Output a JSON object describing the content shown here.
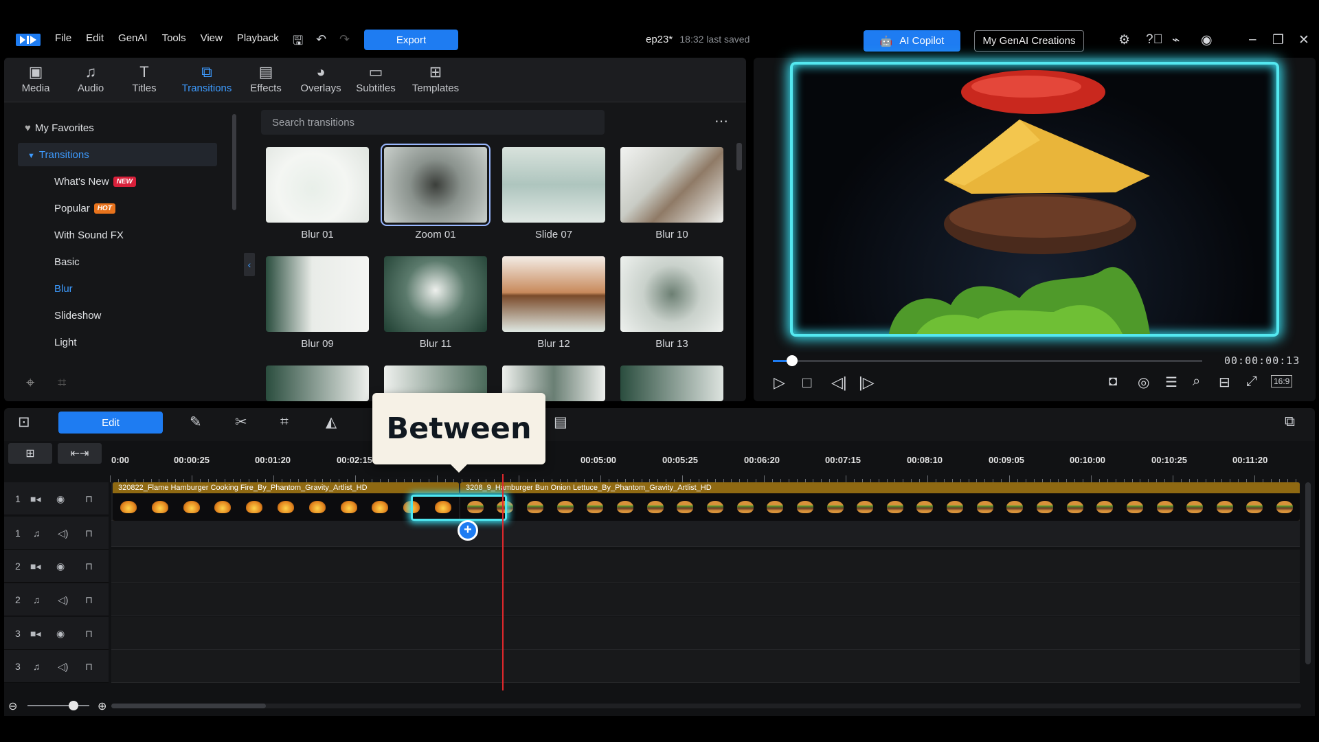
{
  "menu": {
    "items": [
      "File",
      "Edit",
      "GenAI",
      "Tools",
      "View",
      "Playback"
    ],
    "export_label": "Export"
  },
  "project": {
    "name": "ep23*",
    "saved": "18:32 last saved"
  },
  "header": {
    "copilot_label": "AI Copilot",
    "creations_label": "My GenAI Creations"
  },
  "tabs": [
    {
      "label": "Media",
      "icon": "media-icon"
    },
    {
      "label": "Audio",
      "icon": "music-note-icon"
    },
    {
      "label": "Titles",
      "icon": "text-icon"
    },
    {
      "label": "Transitions",
      "icon": "transition-icon",
      "active": true
    },
    {
      "label": "Effects",
      "icon": "effects-icon"
    },
    {
      "label": "Overlays",
      "icon": "overlay-icon"
    },
    {
      "label": "Subtitles",
      "icon": "subtitles-icon"
    },
    {
      "label": "Templates",
      "icon": "templates-icon"
    }
  ],
  "sidebar": {
    "favorites": "My Favorites",
    "transitions": "Transitions",
    "items": [
      {
        "label": "What's New",
        "badge": "NEW"
      },
      {
        "label": "Popular",
        "badge": "HOT"
      },
      {
        "label": "With Sound FX"
      },
      {
        "label": "Basic"
      },
      {
        "label": "Blur",
        "active": true
      },
      {
        "label": "Slideshow"
      },
      {
        "label": "Light"
      }
    ]
  },
  "search": {
    "placeholder": "Search transitions"
  },
  "grid": [
    {
      "label": "Blur 01"
    },
    {
      "label": "Zoom 01",
      "selected": true
    },
    {
      "label": "Slide 07"
    },
    {
      "label": "Blur 10"
    },
    {
      "label": "Blur 09"
    },
    {
      "label": "Blur 11"
    },
    {
      "label": "Blur 12"
    },
    {
      "label": "Blur 13"
    }
  ],
  "player": {
    "timecode": "00:00:00:13",
    "progress": 0.04,
    "aspect": "16:9"
  },
  "edit": {
    "label": "Edit"
  },
  "callout": {
    "text": "Between"
  },
  "ruler": {
    "labels": [
      "0:00",
      "00:00:25",
      "00:01:20",
      "00:02:15",
      "00:05:00",
      "00:05:25",
      "00:06:20",
      "00:07:15",
      "00:08:10",
      "00:09:05",
      "00:10:00",
      "00:10:25",
      "00:11:20"
    ]
  },
  "tracks": [
    {
      "num": "1",
      "type": "video"
    },
    {
      "num": "1",
      "type": "audio"
    },
    {
      "num": "2",
      "type": "video"
    },
    {
      "num": "2",
      "type": "audio"
    },
    {
      "num": "3",
      "type": "video"
    },
    {
      "num": "3",
      "type": "audio"
    }
  ],
  "clips": [
    {
      "title": "320822_Flame Hamburger Cooking Fire_By_Phantom_Gravity_Artlist_HD"
    },
    {
      "title": "3208_9_Hamburger Bun Onion Lettuce_By_Phantom_Gravity_Artlist_HD"
    }
  ],
  "colors": {
    "accent": "#1e7cf2",
    "glow": "#4fe6ef",
    "clip": "#8f6912",
    "playhead": "#e0282c"
  }
}
